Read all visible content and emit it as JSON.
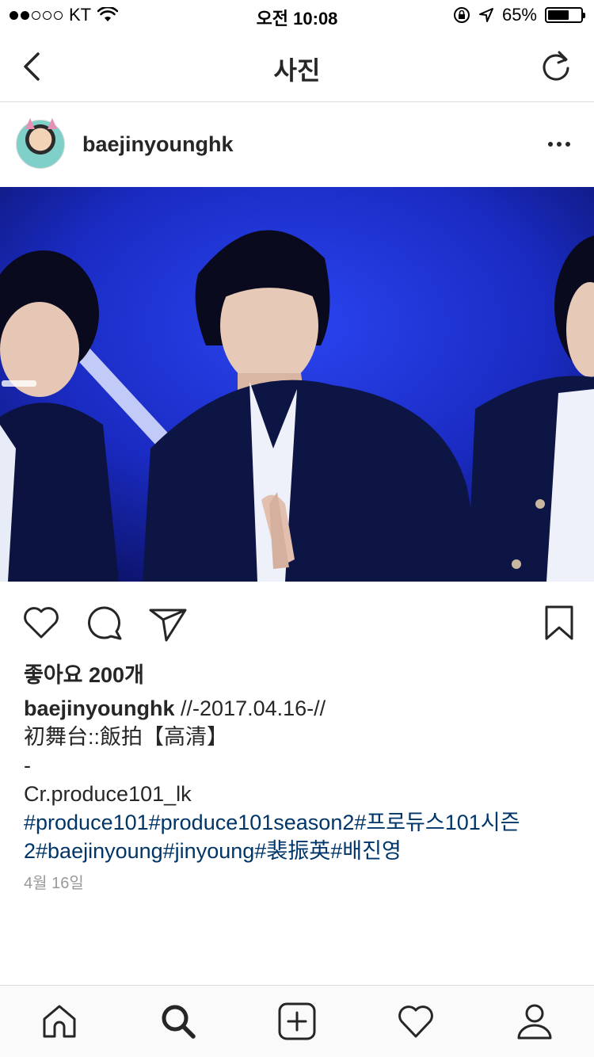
{
  "status_bar": {
    "carrier": "KT",
    "time": "오전 10:08",
    "battery_percent": "65%",
    "battery_level": 0.65
  },
  "nav": {
    "title": "사진",
    "back_icon": "chevron-left-icon",
    "refresh_icon": "refresh-icon"
  },
  "post": {
    "username": "baejinyounghk",
    "likes": "좋아요 200개",
    "caption": {
      "user": "baejinyounghk",
      "line1": "//-2017.04.16-//",
      "line2": "初舞台::飯拍【高清】",
      "line3": "-",
      "line4": "Cr.produce101_lk",
      "hashtags_line1": "#produce101#produce101season2#프로듀스101시즌",
      "hashtags_line2": "2#baejinyoung#jinyoung#裴振英#배진영"
    },
    "date": "4월 16일"
  },
  "colors": {
    "hashtag": "#003569",
    "photo_bg": "#1a2fd0",
    "divider": "#dbdbdb"
  },
  "tabbar": {
    "items": [
      "home-icon",
      "search-icon",
      "add-post-icon",
      "activity-heart-icon",
      "profile-icon"
    ]
  }
}
